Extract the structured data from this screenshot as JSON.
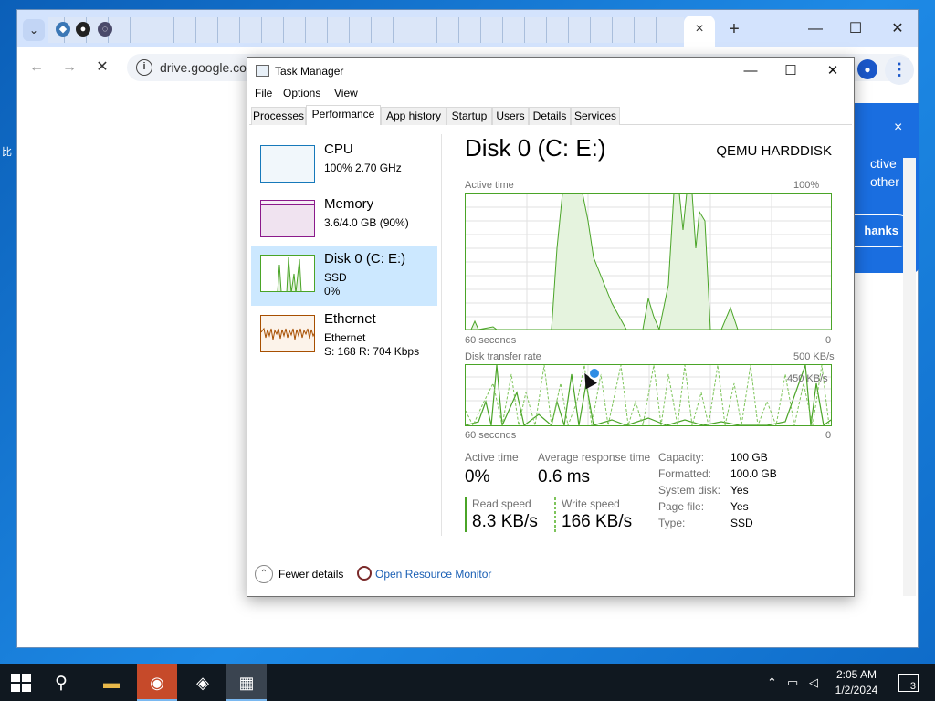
{
  "desktop": {
    "side_text": "比"
  },
  "browser": {
    "url": "drive.google.co",
    "active_tab_close": "×",
    "new_tab": "+",
    "tab_search_glyph": "⌄",
    "popup": {
      "close": "×",
      "line1": "ctive",
      "line2": "other",
      "button": "hanks"
    }
  },
  "task_manager": {
    "title": "Task Manager",
    "menu": [
      "File",
      "Options",
      "View"
    ],
    "tabs": [
      "Processes",
      "Performance",
      "App history",
      "Startup",
      "Users",
      "Details",
      "Services"
    ],
    "active_tab": "Performance",
    "sidebar": [
      {
        "title": "CPU",
        "sub1": "100% 2.70 GHz",
        "sub2": "",
        "color": "#1779ba"
      },
      {
        "title": "Memory",
        "sub1": "3.6/4.0 GB (90%)",
        "sub2": "",
        "color": "#8b1a8b"
      },
      {
        "title": "Disk 0 (C: E:)",
        "sub1": "SSD",
        "sub2": "0%",
        "color": "#4aa427"
      },
      {
        "title": "Ethernet",
        "sub1": "Ethernet",
        "sub2": "S: 168  R: 704 Kbps",
        "color": "#a74f01"
      }
    ],
    "detail": {
      "title": "Disk 0 (C: E:)",
      "model": "QEMU HARDDISK",
      "graph1": {
        "label": "Active time",
        "max_label": "100%",
        "x_label": "60 seconds",
        "min_label": "0"
      },
      "graph2": {
        "label": "Disk transfer rate",
        "max_label": "500 KB/s",
        "inner_label": "450 KB/s",
        "x_label": "60 seconds",
        "min_label": "0"
      },
      "stats": {
        "active_time_label": "Active time",
        "active_time_value": "0%",
        "avg_response_label": "Average response time",
        "avg_response_value": "0.6 ms",
        "read_label": "Read speed",
        "read_value": "8.3 KB/s",
        "write_label": "Write speed",
        "write_value": "166 KB/s"
      },
      "properties": [
        {
          "label": "Capacity:",
          "value": "100 GB"
        },
        {
          "label": "Formatted:",
          "value": "100.0 GB"
        },
        {
          "label": "System disk:",
          "value": "Yes"
        },
        {
          "label": "Page file:",
          "value": "Yes"
        },
        {
          "label": "Type:",
          "value": "SSD"
        }
      ]
    },
    "footer": {
      "fewer_details": "Fewer details",
      "resource_monitor": "Open Resource Monitor"
    }
  },
  "taskbar": {
    "time": "2:05 AM",
    "date": "1/2/2024",
    "notifications": "3"
  },
  "accent_colors": {
    "disk": "#4aa427",
    "selected": "#cce8ff",
    "link": "#1a5fb4"
  }
}
